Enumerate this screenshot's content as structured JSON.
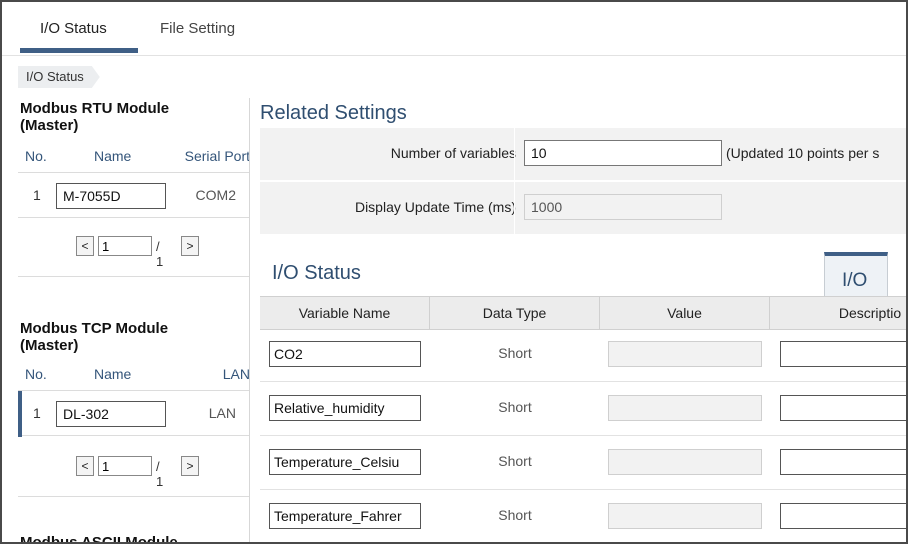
{
  "tabs": [
    {
      "label": "I/O Status",
      "active": true
    },
    {
      "label": "File Setting",
      "active": false
    }
  ],
  "breadcrumb": "I/O Status",
  "modules": {
    "rtu": {
      "title_line1": "Modbus RTU Module",
      "title_line2": "(Master)",
      "headers": {
        "no": "No.",
        "name": "Name",
        "port": "Serial Port"
      },
      "rows": [
        {
          "no": "1",
          "name": "M-7055D",
          "port": "COM2"
        }
      ],
      "pager": {
        "prev": "<",
        "page": "1",
        "total": "/ 1",
        "next": ">"
      }
    },
    "tcp": {
      "title_line1": "Modbus TCP Module",
      "title_line2": "(Master)",
      "headers": {
        "no": "No.",
        "name": "Name",
        "port": "LAN"
      },
      "rows": [
        {
          "no": "1",
          "name": "DL-302",
          "port": "LAN"
        }
      ],
      "pager": {
        "prev": "<",
        "page": "1",
        "total": "/ 1",
        "next": ">"
      }
    },
    "ascii": {
      "title_line1": "Modbus ASCII Module"
    }
  },
  "related_settings": {
    "title": "Related Settings",
    "number_of_variables": {
      "label": "Number of variables",
      "value": "10",
      "note": "(Updated 10 points per s"
    },
    "display_update_time": {
      "label": "Display Update Time (ms)",
      "value": "1000"
    }
  },
  "io_status": {
    "title": "I/O Status",
    "side_tab": "I/O",
    "columns": [
      "Variable Name",
      "Data Type",
      "Value",
      "Descriptio"
    ],
    "rows": [
      {
        "name": "CO2",
        "type": "Short",
        "value": "",
        "desc": ""
      },
      {
        "name": "Relative_humidity",
        "type": "Short",
        "value": "",
        "desc": ""
      },
      {
        "name": "Temperature_Celsiu",
        "type": "Short",
        "value": "",
        "desc": ""
      },
      {
        "name": "Temperature_Fahrer",
        "type": "Short",
        "value": "",
        "desc": ""
      }
    ]
  },
  "colors": {
    "accent": "#3f5f86",
    "heading": "#2f4e70",
    "row_bg": "#f2f2f2"
  }
}
